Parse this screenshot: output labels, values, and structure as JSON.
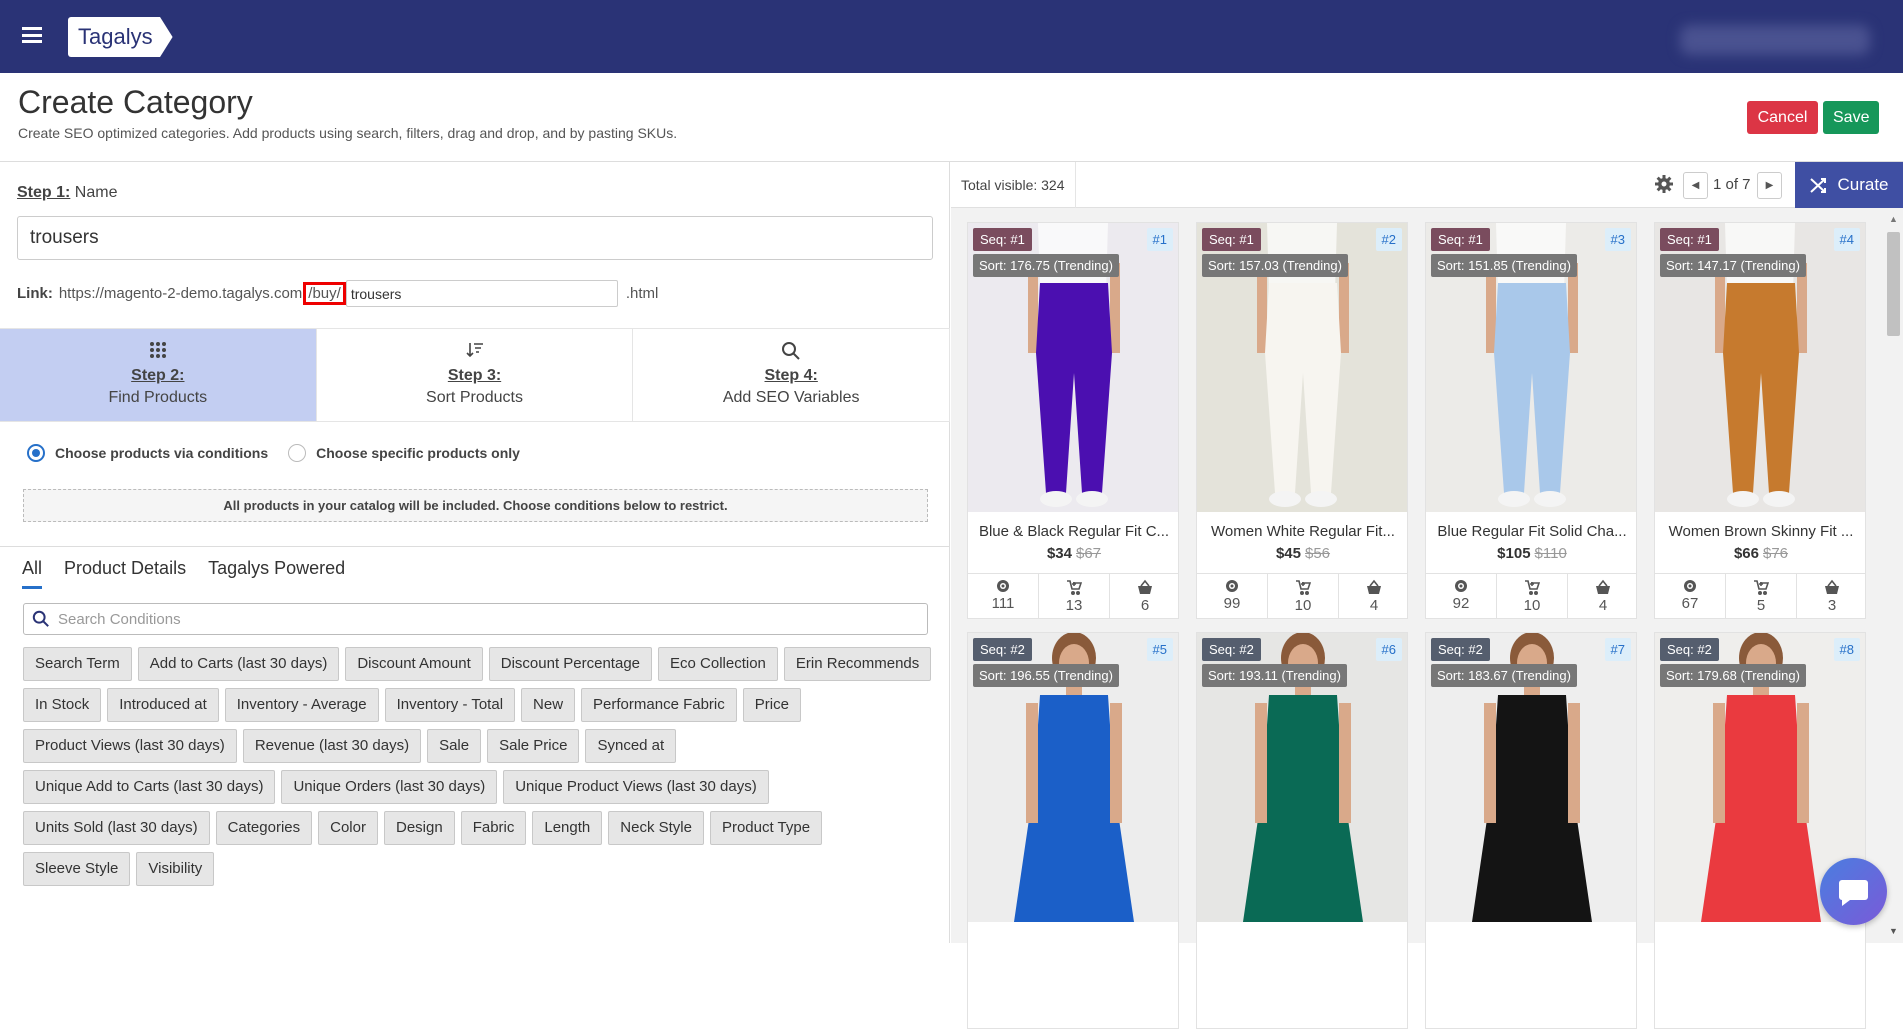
{
  "app": {
    "logo": "Tagalys",
    "menu_icon": "hamburger-icon"
  },
  "colors": {
    "header": "#2a3376",
    "accent": "#2670c9",
    "cancel": "#dc3545",
    "save": "#16975a",
    "curate": "#3f4fa3",
    "active_step": "#c3cef2"
  },
  "page": {
    "title": "Create Category",
    "subtitle": "Create SEO optimized categories. Add products using search, filters, drag and drop, and by pasting SKUs.",
    "cancel_label": "Cancel",
    "save_label": "Save"
  },
  "step1": {
    "label": "Step 1:",
    "sublabel": "Name",
    "name_value": "trousers",
    "link_label": "Link:",
    "link_base": "https://magento-2-demo.tagalys.com",
    "link_prefix": "/buy/",
    "slug_value": "trousers",
    "link_suffix": ".html"
  },
  "steps": [
    {
      "label": "Step 2:",
      "sub": "Find Products",
      "icon": "grid-dots-icon",
      "active": true
    },
    {
      "label": "Step 3:",
      "sub": "Sort Products",
      "icon": "sort-icon",
      "active": false
    },
    {
      "label": "Step 4:",
      "sub": "Add SEO Variables",
      "icon": "search-icon",
      "active": false
    }
  ],
  "mode": {
    "option1": "Choose products via conditions",
    "option2": "Choose specific products only",
    "selected": "option1",
    "info": "All products in your catalog will be included. Choose conditions below to restrict."
  },
  "condition_tabs": [
    "All",
    "Product Details",
    "Tagalys Powered"
  ],
  "search": {
    "placeholder": "Search Conditions",
    "value": ""
  },
  "conditions": [
    "Search Term",
    "Add to Carts (last 30 days)",
    "Discount Amount",
    "Discount Percentage",
    "Eco Collection",
    "Erin Recommends",
    "In Stock",
    "Introduced at",
    "Inventory - Average",
    "Inventory - Total",
    "New",
    "Performance Fabric",
    "Price",
    "Product Views (last 30 days)",
    "Revenue (last 30 days)",
    "Sale",
    "Sale Price",
    "Synced at",
    "Unique Add to Carts (last 30 days)",
    "Unique Orders (last 30 days)",
    "Unique Product Views (last 30 days)",
    "Units Sold (last 30 days)",
    "Categories",
    "Color",
    "Design",
    "Fabric",
    "Length",
    "Neck Style",
    "Product Type",
    "Sleeve Style",
    "Visibility"
  ],
  "results": {
    "total_label": "Total visible: 324",
    "page_text": "1 of 7",
    "curate_label": "Curate"
  },
  "products": [
    {
      "seq": "Seq: #1",
      "sort": "Sort: 176.75 (Trending)",
      "pos": "#1",
      "name": "Blue & Black Regular Fit C...",
      "price": "$34",
      "orig": "$67",
      "views": "111",
      "carts": "13",
      "orders": "6",
      "kind": "pants",
      "color": "#4b0fb0",
      "bg": "#eceaef"
    },
    {
      "seq": "Seq: #1",
      "sort": "Sort: 157.03 (Trending)",
      "pos": "#2",
      "name": "Women White Regular Fit...",
      "price": "$45",
      "orig": "$56",
      "views": "99",
      "carts": "10",
      "orders": "4",
      "kind": "pants",
      "color": "#f7f5f0",
      "bg": "#e4e3da"
    },
    {
      "seq": "Seq: #1",
      "sort": "Sort: 151.85 (Trending)",
      "pos": "#3",
      "name": "Blue Regular Fit Solid Cha...",
      "price": "$105",
      "orig": "$110",
      "views": "92",
      "carts": "10",
      "orders": "4",
      "kind": "pants",
      "color": "#a9c8ea",
      "bg": "#ecebe8"
    },
    {
      "seq": "Seq: #1",
      "sort": "Sort: 147.17 (Trending)",
      "pos": "#4",
      "name": "Women Brown Skinny Fit ...",
      "price": "$66",
      "orig": "$76",
      "views": "67",
      "carts": "5",
      "orders": "3",
      "kind": "pants",
      "color": "#c67a2e",
      "bg": "#e8e6e4"
    },
    {
      "seq": "Seq: #2",
      "sort": "Sort: 196.55 (Trending)",
      "pos": "#5",
      "kind": "dress",
      "color": "#1b5fc8",
      "bg": "#ededed"
    },
    {
      "seq": "Seq: #2",
      "sort": "Sort: 193.11 (Trending)",
      "pos": "#6",
      "kind": "dress",
      "color": "#0a6a55",
      "bg": "#e6e6e4"
    },
    {
      "seq": "Seq: #2",
      "sort": "Sort: 183.67 (Trending)",
      "pos": "#7",
      "kind": "dress",
      "color": "#141414",
      "bg": "#eeeeee"
    },
    {
      "seq": "Seq: #2",
      "sort": "Sort: 179.68 (Trending)",
      "pos": "#8",
      "kind": "dress",
      "color": "#ea3a3f",
      "bg": "#efeeec"
    }
  ]
}
